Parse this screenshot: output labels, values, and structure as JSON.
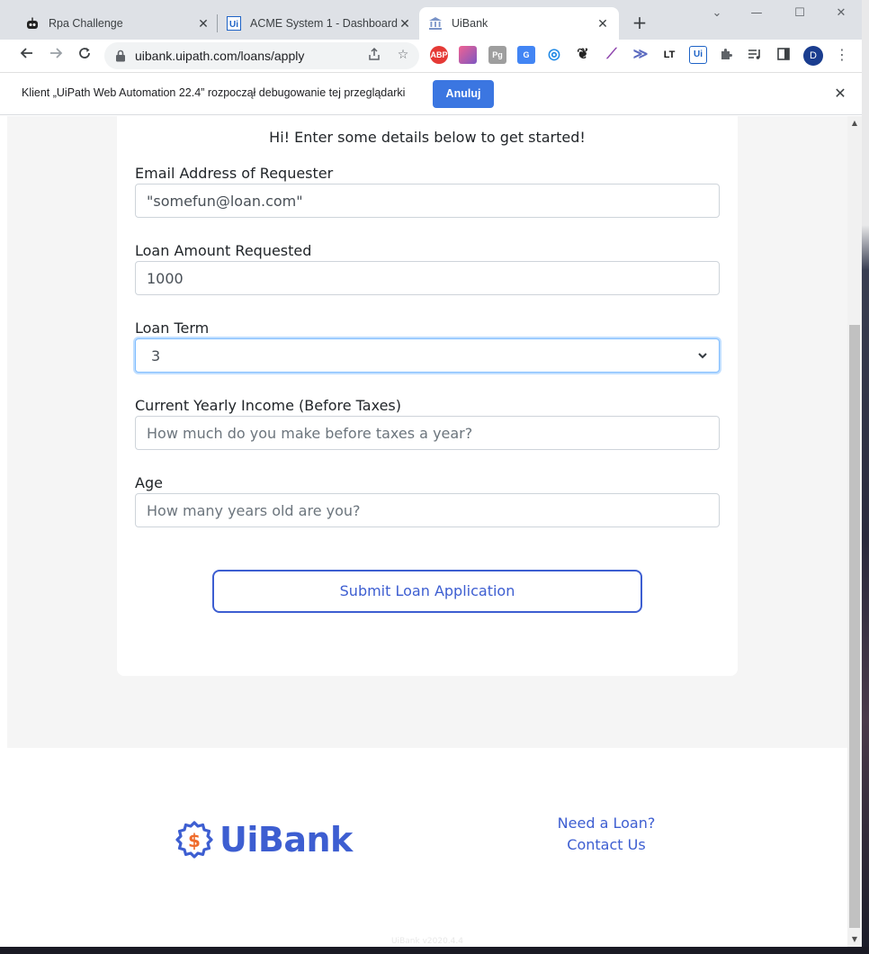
{
  "tabs": [
    {
      "label": "Rpa Challenge",
      "icon": "robot-icon"
    },
    {
      "label": "ACME System 1 - Dashboard",
      "icon": "uipath-icon"
    },
    {
      "label": "UiBank",
      "icon": "bank-icon",
      "active": true
    }
  ],
  "address_bar": {
    "url": "uibank.uipath.com/loans/apply"
  },
  "profile": {
    "initial": "D"
  },
  "extensions": [
    {
      "name": "adblock-icon",
      "label": "ABP",
      "color": "#e53935"
    },
    {
      "name": "gradient-icon",
      "label": "",
      "color": "#c04fa5"
    },
    {
      "name": "pg-icon",
      "label": "Pg",
      "color": "#9e9e9e"
    },
    {
      "name": "translate-icon",
      "label": "G",
      "color": "#4285f4"
    },
    {
      "name": "circle-icon",
      "label": "◎",
      "color": "#1e88e5"
    },
    {
      "name": "gnu-icon",
      "label": "❦",
      "color": "#222222"
    },
    {
      "name": "feather-icon",
      "label": "⟋",
      "color": "#8e44ad"
    },
    {
      "name": "chevron-ext-icon",
      "label": "≫",
      "color": "#5c6bc0"
    },
    {
      "name": "lt-icon",
      "label": "LT",
      "color": "#111111"
    },
    {
      "name": "ui-ext-icon",
      "label": "Ui",
      "color": "#1e63c6"
    }
  ],
  "infobar": {
    "message": "Klient „UiPath Web Automation 22.4” rozpoczął debugowanie tej przeglądarki",
    "cancel_label": "Anuluj"
  },
  "form": {
    "greeting": "Hi! Enter some details below to get started!",
    "email": {
      "label": "Email Address of Requester",
      "value": "\"somefun@loan.com\""
    },
    "amount": {
      "label": "Loan Amount Requested",
      "value": "1000"
    },
    "term": {
      "label": "Loan Term",
      "value": "3"
    },
    "income": {
      "label": "Current Yearly Income (Before Taxes)",
      "placeholder": "How much do you make before taxes a year?"
    },
    "age": {
      "label": "Age",
      "placeholder": "How many years old are you?"
    },
    "submit_label": "Submit Loan Application"
  },
  "footer": {
    "brand": "UiBank",
    "links": [
      "Need a Loan?",
      "Contact Us"
    ],
    "version": "UiBank v2020.4.4"
  },
  "colors": {
    "brand": "#3d5ed1",
    "accent_orange": "#ef6b2b",
    "chrome_blue": "#3b76e1"
  }
}
